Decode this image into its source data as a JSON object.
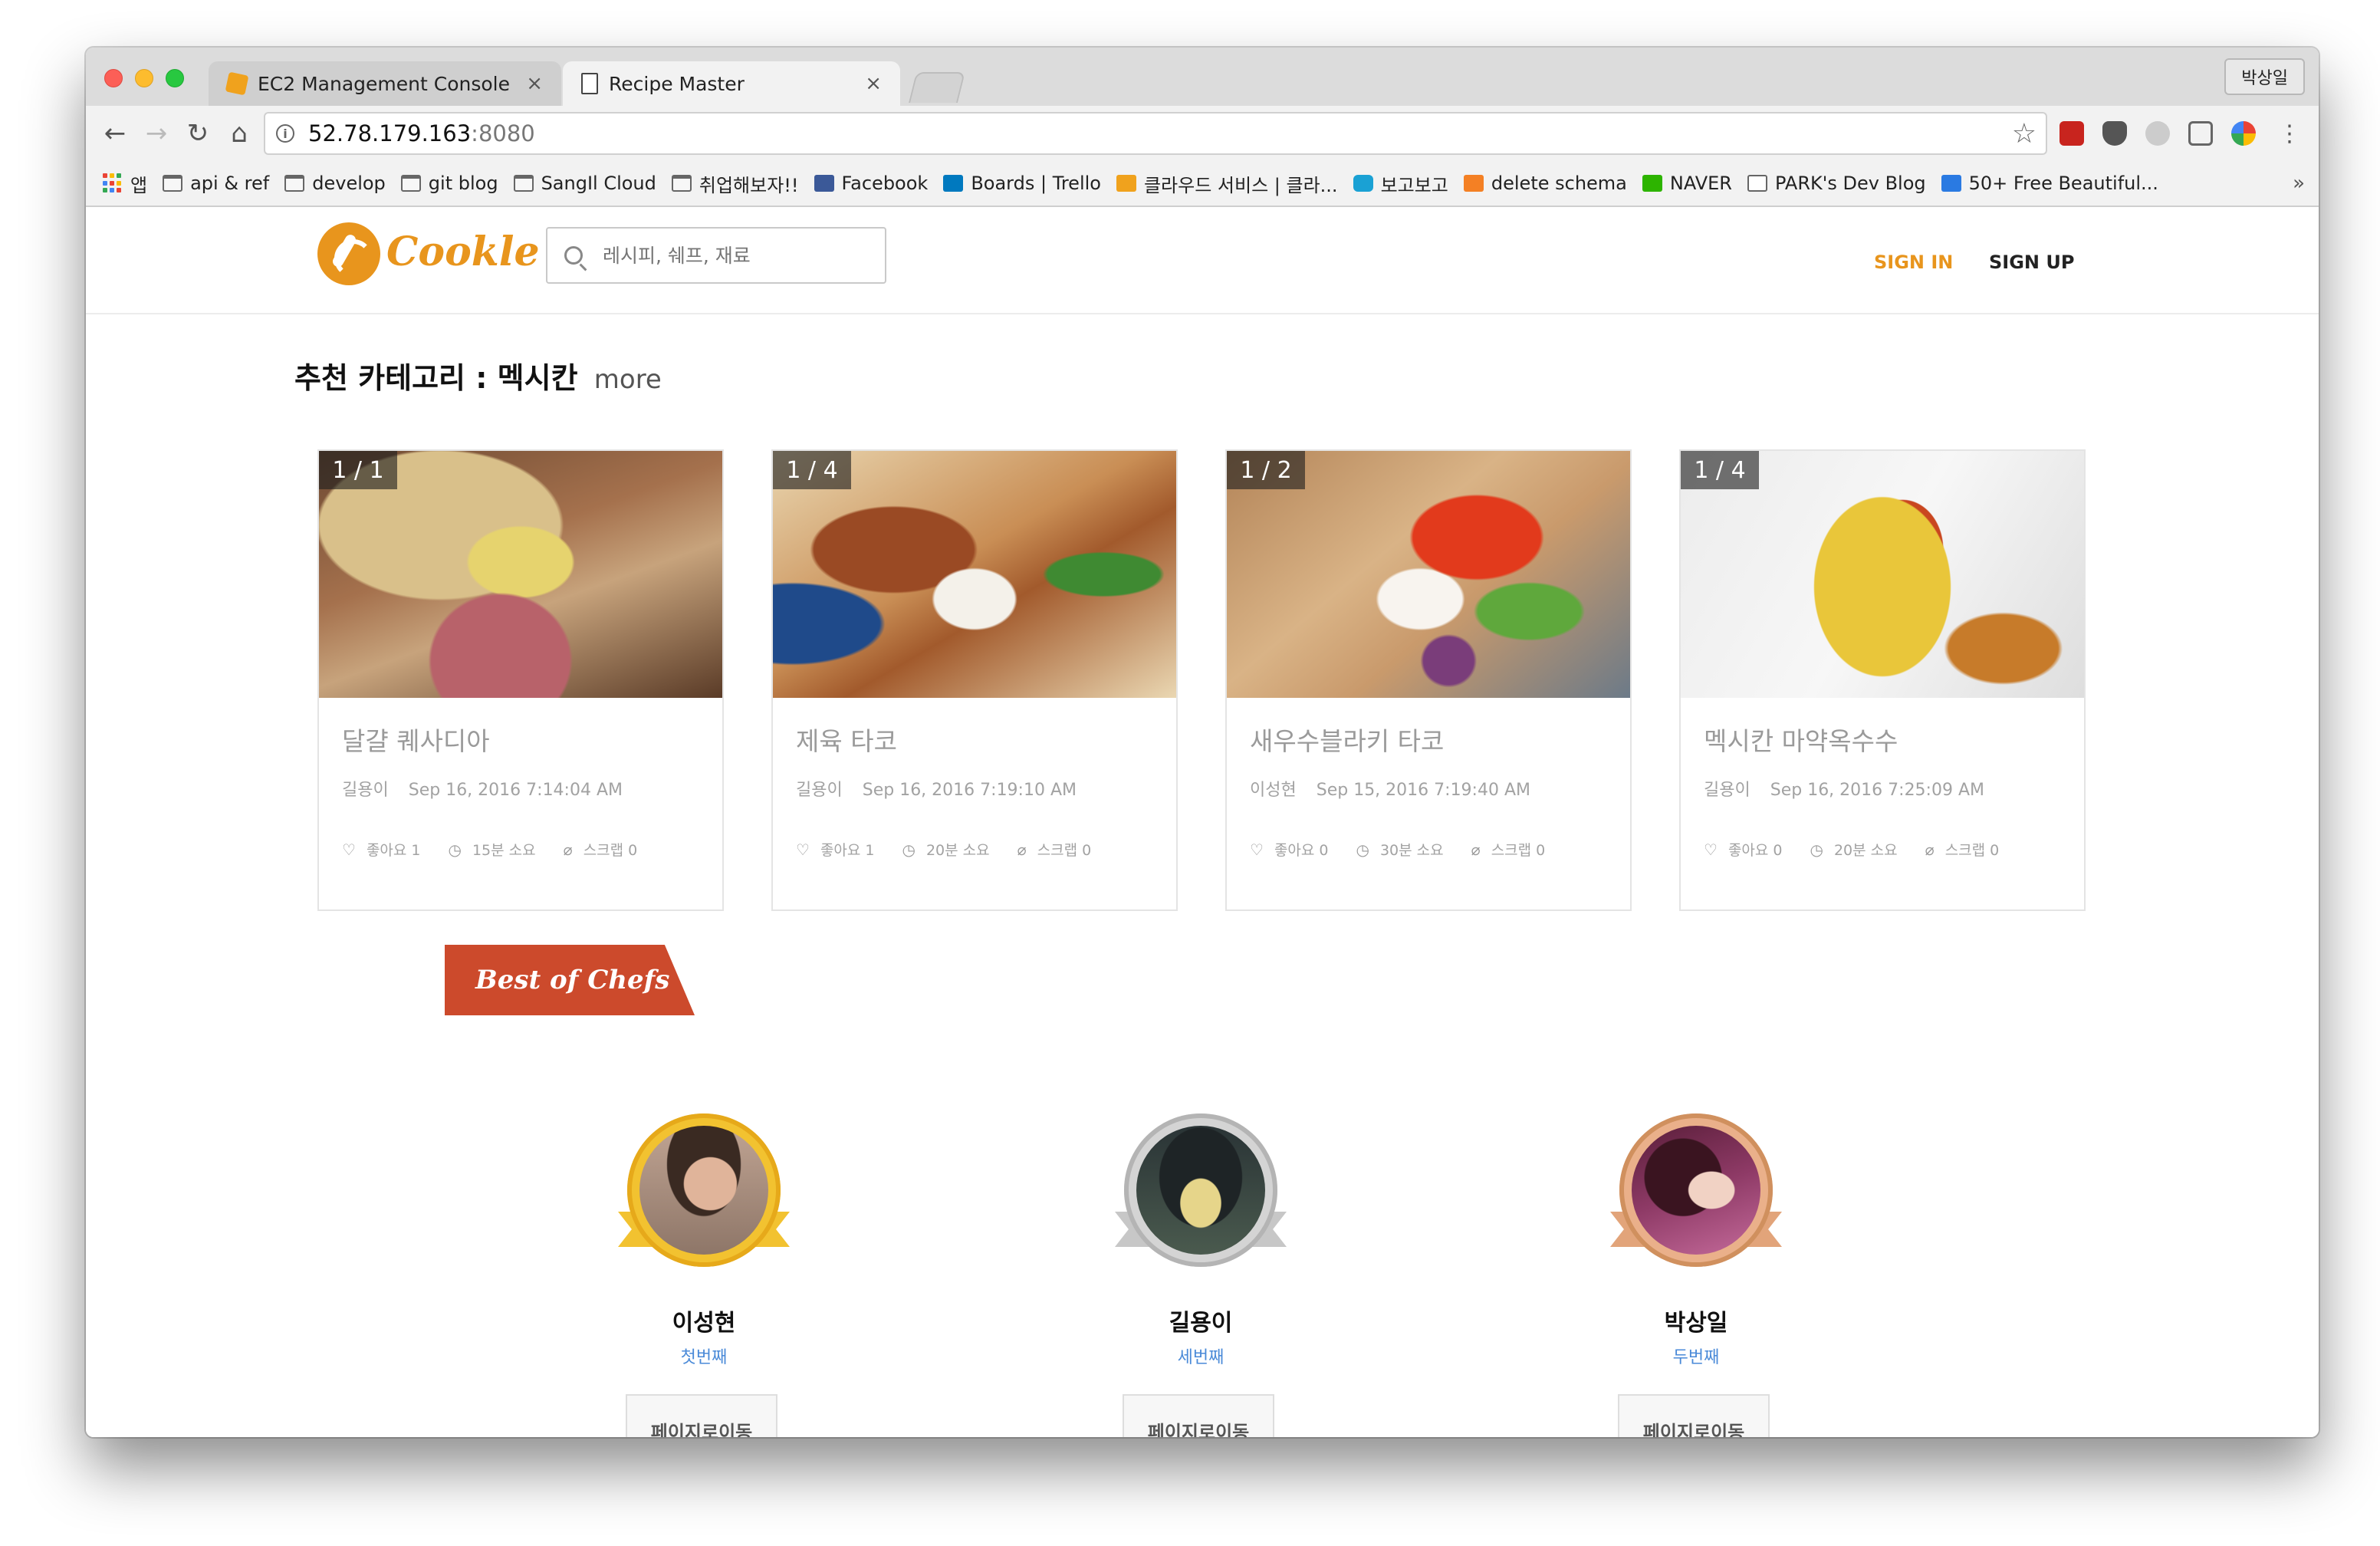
{
  "browser": {
    "tabs": [
      {
        "title": "EC2 Management Console",
        "close": "×"
      },
      {
        "title": "Recipe Master",
        "close": "×"
      }
    ],
    "profile": "박상일",
    "url_host": "52.78.179.163",
    "url_port": ":8080",
    "bookmarks": [
      "앱",
      "api & ref",
      "develop",
      "git blog",
      "SangIl Cloud",
      "취업해보자!!",
      "Facebook",
      "Boards | Trello",
      "클라우드 서비스 | 클라...",
      "보고보고",
      "delete schema",
      "NAVER",
      "PARK's Dev Blog",
      "50+ Free Beautiful..."
    ],
    "bookmarks_more": "»"
  },
  "site": {
    "logo": "Cookle",
    "search_placeholder": "레시피, 쉐프, 재료",
    "sign_in": "SIGN IN",
    "sign_up": "SIGN UP"
  },
  "section": {
    "title": "추천 카테고리 : 멕시칸",
    "more": "more"
  },
  "cards": [
    {
      "badge": "1 / 1",
      "title": "달걀 퀘사디아",
      "author": "길용이",
      "date": "Sep 16, 2016 7:14:04 AM",
      "likes": "좋아요 1",
      "time": "15분 소요",
      "scraps": "스크랩 0"
    },
    {
      "badge": "1 / 4",
      "title": "제육 타코",
      "author": "길용이",
      "date": "Sep 16, 2016 7:19:10 AM",
      "likes": "좋아요 1",
      "time": "20분 소요",
      "scraps": "스크랩 0"
    },
    {
      "badge": "1 / 2",
      "title": "새우수블라키 타코",
      "author": "이성현",
      "date": "Sep 15, 2016 7:19:40 AM",
      "likes": "좋아요 0",
      "time": "30분 소요",
      "scraps": "스크랩 0"
    },
    {
      "badge": "1 / 4",
      "title": "멕시칸 마약옥수수",
      "author": "길용이",
      "date": "Sep 16, 2016 7:25:09 AM",
      "likes": "좋아요 0",
      "time": "20분 소요",
      "scraps": "스크랩 0"
    }
  ],
  "best_chefs": {
    "title": "Best of Chefs",
    "chefs": [
      {
        "name": "이성현",
        "rank": "첫번째",
        "button": "페이지로이동",
        "medal": "#f2c230"
      },
      {
        "name": "길용이",
        "rank": "세번째",
        "button": "페이지로이동",
        "medal": "#c7c7c7"
      },
      {
        "name": "박상일",
        "rank": "두번째",
        "button": "페이지로이동",
        "medal": "#e2a47a"
      }
    ]
  },
  "colors": {
    "accent": "#e8951d",
    "chefs_banner": "#cc4a2c",
    "rank_link": "#4a8ad8"
  }
}
